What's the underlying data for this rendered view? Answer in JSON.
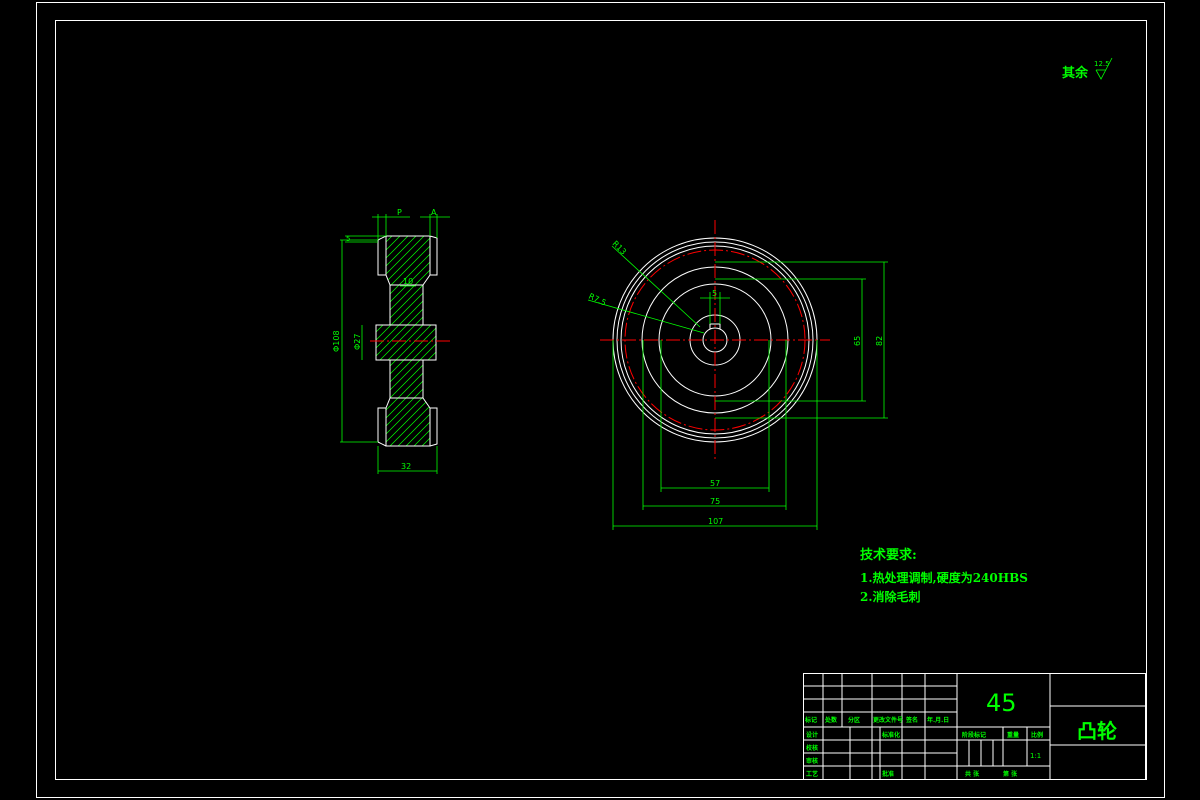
{
  "roughness_note": {
    "prefix": "其余",
    "value": "12.5"
  },
  "dimensions": {
    "side": {
      "p": "P",
      "a": "A",
      "d5": "5",
      "d10": "10",
      "phi27": "Φ27",
      "phi108": "Φ108",
      "w32": "32"
    },
    "front": {
      "r13": "R13",
      "r75": "R7.5",
      "d5": "5",
      "d65": "65",
      "d82": "82",
      "d57": "57",
      "d75": "75",
      "d107": "107"
    }
  },
  "tech_requirements": {
    "title": "技术要求:",
    "items": [
      "1.热处理调制,硬度为240HBS",
      "2.消除毛刺"
    ]
  },
  "title_block": {
    "material": "45",
    "part_name": "凸轮",
    "scale": "1:1",
    "header_row": [
      "标记",
      "处数",
      "分区",
      "更改文件号",
      "签名",
      "年.月.日"
    ],
    "row_labels": [
      "设计",
      "校核",
      "审核",
      "工艺"
    ],
    "standardization": "标准化",
    "approval": "批准",
    "stage_labels": [
      "阶段标记",
      "重量",
      "比例"
    ],
    "sheets": [
      "共 张",
      "第 张"
    ]
  }
}
